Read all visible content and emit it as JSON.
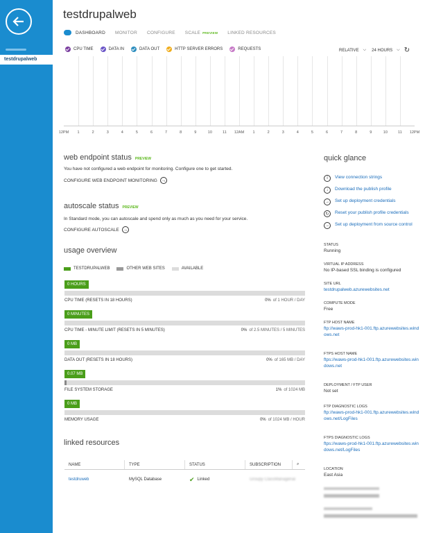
{
  "site_title": "testdrupalweb",
  "sidebar": {
    "active_item": "testdrupalweb"
  },
  "tabs": [
    {
      "label": "DASHBOARD",
      "active": true
    },
    {
      "label": "MONITOR"
    },
    {
      "label": "CONFIGURE"
    },
    {
      "label": "SCALE",
      "badge": "PREVIEW"
    },
    {
      "label": "LINKED RESOURCES"
    }
  ],
  "metrics": [
    {
      "label": "CPU TIME",
      "color": "#7b3fa0"
    },
    {
      "label": "DATA IN",
      "color": "#6b55c7"
    },
    {
      "label": "DATA OUT",
      "color": "#2f8fbf"
    },
    {
      "label": "HTTP SERVER ERRORS",
      "color": "#f0ad1d"
    },
    {
      "label": "REQUESTS",
      "color": "#c77bc7"
    }
  ],
  "chart_controls": {
    "relative": "RELATIVE",
    "range": "24 HOURS"
  },
  "chart_axis": [
    "12PM",
    "1",
    "2",
    "3",
    "4",
    "5",
    "6",
    "7",
    "8",
    "9",
    "10",
    "11",
    "12AM",
    "1",
    "2",
    "3",
    "4",
    "5",
    "6",
    "7",
    "8",
    "9",
    "10",
    "11",
    "12PM"
  ],
  "web_endpoint": {
    "title": "web endpoint status",
    "badge": "PREVIEW",
    "text": "You have not configured a web endpoint for monitoring. Configure one to get started.",
    "action": "CONFIGURE WEB ENDPOINT MONITORING"
  },
  "autoscale": {
    "title": "autoscale status",
    "badge": "PREVIEW",
    "text": "In Standard mode, you can autoscale and spend only as much as you need for your service.",
    "action": "CONFIGURE AUTOSCALE"
  },
  "usage": {
    "title": "usage overview",
    "legend": [
      {
        "label": "TESTDRUPALWEB",
        "color": "#4a9e1a"
      },
      {
        "label": "OTHER WEB SITES",
        "color": "#999999"
      },
      {
        "label": "AVAILABLE",
        "color": "#dcdcdc"
      }
    ],
    "items": [
      {
        "badge": "0 HOURS",
        "label": "CPU TIME (RESETS IN 18 HOURS)",
        "value_pct": "0%",
        "value_rest": "of 1 HOUR / DAY",
        "fill": 0
      },
      {
        "badge": "0 MINUTES",
        "label": "CPU TIME - MINUTE LIMIT (RESETS IN 5 MINUTES)",
        "value_pct": "0%",
        "value_rest": "of 2.5 MINUTES / 5 MINUTES",
        "fill": 0
      },
      {
        "badge": "0 MB",
        "label": "DATA OUT (RESETS IN 18 HOURS)",
        "value_pct": "0%",
        "value_rest": "of 165 MB / DAY",
        "fill": 0
      },
      {
        "badge": "0.07 MB",
        "label": "FILE SYSTEM STORAGE",
        "value_pct": "1%",
        "value_rest": "of 1024 MB",
        "fill": 1
      },
      {
        "badge": "0 MB",
        "label": "MEMORY USAGE",
        "value_pct": "0%",
        "value_rest": "of 1024 MB / HOUR",
        "fill": 0
      }
    ]
  },
  "linked": {
    "title": "linked resources",
    "headers": [
      "NAME",
      "TYPE",
      "STATUS",
      "SUBSCRIPTION"
    ],
    "rows": [
      {
        "name": "testdruweb",
        "type": "MySQL Database",
        "status": "Linked",
        "subscription": "Groupy ClassManagerial"
      }
    ]
  },
  "quick_glance": {
    "title": "quick glance",
    "links": [
      {
        "label": "View connection strings",
        "icon": "info-icon"
      },
      {
        "label": "Download the publish profile",
        "icon": "download-icon"
      },
      {
        "label": "Set up deployment credentials",
        "icon": "arrow-right-icon"
      },
      {
        "label": "Reset your publish profile credentials",
        "icon": "refresh-icon"
      },
      {
        "label": "Set up deployment from source control",
        "icon": "arrow-right-icon"
      }
    ],
    "props": [
      {
        "key": "STATUS",
        "value": "Running"
      },
      {
        "key": "VIRTUAL IP ADDRESS",
        "value": "No IP-based SSL binding is configured"
      },
      {
        "key": "SITE URL",
        "value": "testdrupalweb.azurewebsites.net",
        "link": true
      },
      {
        "key": "COMPUTE MODE",
        "value": "Free"
      },
      {
        "key": "FTP HOST NAME",
        "value": "ftp://waws-prod-hk1-001.ftp.azurewebsites.windows.net",
        "link": true
      },
      {
        "key": "FTPS HOST NAME",
        "value": "ftps://waws-prod-hk1-001.ftp.azurewebsites.windows.net",
        "link": true
      },
      {
        "key": "DEPLOYMENT / FTP USER",
        "value": "Not set"
      },
      {
        "key": "FTP DIAGNOSTIC LOGS",
        "value": "ftp://waws-prod-hk1-001.ftp.azurewebsites.windows.net/LogFiles",
        "link": true
      },
      {
        "key": "FTPS DIAGNOSTIC LOGS",
        "value": "ftps://waws-prod-hk1-001.ftp.azurewebsites.windows.net/LogFiles",
        "link": true
      },
      {
        "key": "LOCATION",
        "value": "East Asia"
      }
    ]
  }
}
